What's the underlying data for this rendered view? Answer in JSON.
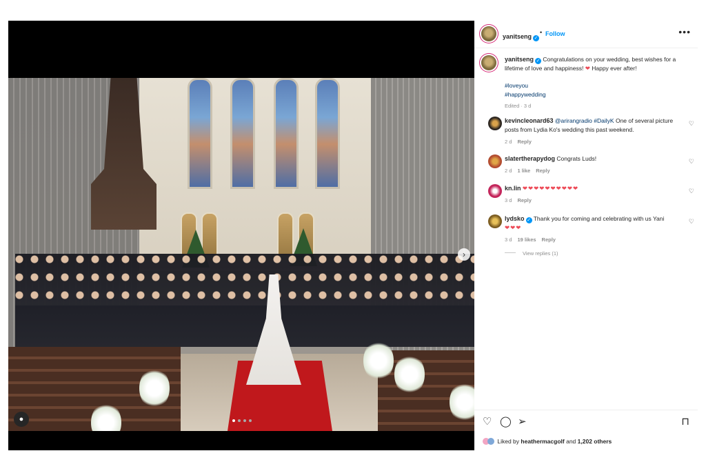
{
  "post": {
    "author": "yanitseng",
    "follow_label": "Follow",
    "separator": "•",
    "more_icon": "more-horizontal-icon",
    "accent_color": "#0095f6"
  },
  "media": {
    "carousel_dots": 4,
    "carousel_active_index": 0,
    "next_icon": "chevron-right-icon",
    "tag_icon": "user-tag-icon"
  },
  "caption": {
    "author": "yanitseng",
    "text": "Congratulations on your wedding, best wishes for a lifetime of love and happiness!",
    "heart": "❤️",
    "text2": "Happy ever after!",
    "tags": [
      "#loveyou",
      "#happywedding"
    ],
    "edited": "Edited · 3 d"
  },
  "comments": [
    {
      "user": "kevincleonard63",
      "mention": "@arirangradio",
      "hashtag": "#DailyK",
      "text": "One of several picture posts from Lydia Ko's wedding this past weekend.",
      "time": "2 d",
      "likes": "",
      "reply": "Reply"
    },
    {
      "user": "slatertherapydog",
      "text": "Congrats Luds!",
      "time": "2 d",
      "likes": "1 like",
      "reply": "Reply"
    },
    {
      "user": "kn.lin",
      "text": "❤❤❤❤❤❤❤❤❤❤",
      "time": "3 d",
      "likes": "",
      "reply": "Reply"
    },
    {
      "user": "lydsko",
      "text": "Thank you for coming and celebrating with us Yani",
      "hearts": "❤❤❤",
      "time": "3 d",
      "likes": "19 likes",
      "reply": "Reply",
      "view_replies": "View replies (1)"
    }
  ],
  "actions": {
    "like_icon": "heart-outline-icon",
    "comment_icon": "comment-icon",
    "share_icon": "share-icon",
    "save_icon": "bookmark-icon"
  },
  "likes": {
    "prefix": "Liked by",
    "user": "heathermacgolf",
    "and": "and",
    "others": "1,202 others"
  }
}
